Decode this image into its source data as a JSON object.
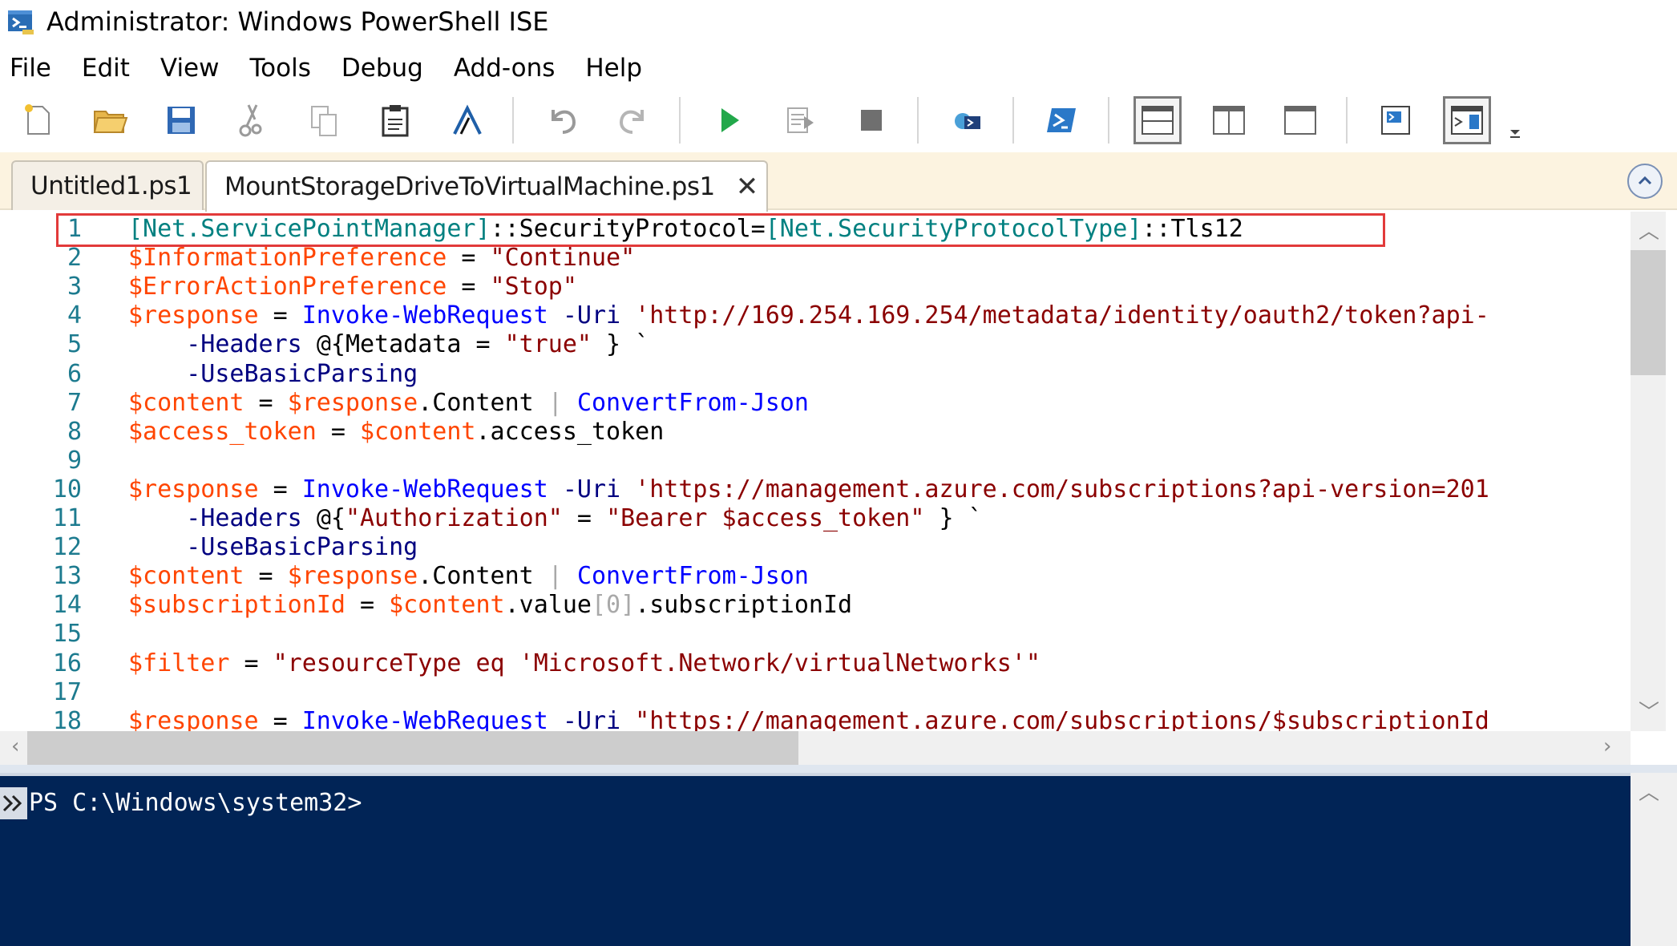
{
  "window": {
    "title": "Administrator: Windows PowerShell ISE",
    "icon": "powershell-ise-icon"
  },
  "menu": [
    "File",
    "Edit",
    "View",
    "Tools",
    "Debug",
    "Add-ons",
    "Help"
  ],
  "toolbar": {
    "icons": [
      "new-script-icon",
      "open-icon",
      "save-icon",
      "cut-icon",
      "copy-icon",
      "paste-icon",
      "clear-console-icon",
      "undo-icon",
      "redo-icon",
      "run-icon",
      "run-selection-icon",
      "stop-icon",
      "remote-powershell-icon",
      "powershell-icon",
      "layout-top-icon",
      "layout-right-icon",
      "layout-maximized-icon",
      "show-script-pane-icon",
      "show-command-addon-icon"
    ]
  },
  "tabs": [
    {
      "label": "Untitled1.ps1",
      "active": false
    },
    {
      "label": "MountStorageDriveToVirtualMachine.ps1",
      "active": true,
      "close": "✕"
    }
  ],
  "editor": {
    "lines": [
      {
        "n": "1",
        "tokens": [
          [
            "[Net.ServicePointManager]",
            "type"
          ],
          [
            "::SecurityProtocol=",
            "plain"
          ],
          [
            "[Net.SecurityProtocolType]",
            "type"
          ],
          [
            "::Tls12",
            "plain"
          ]
        ]
      },
      {
        "n": "2",
        "tokens": [
          [
            "$InformationPreference",
            "var"
          ],
          [
            " = ",
            "plain"
          ],
          [
            "\"Continue\"",
            "str"
          ]
        ]
      },
      {
        "n": "3",
        "tokens": [
          [
            "$ErrorActionPreference",
            "var"
          ],
          [
            " = ",
            "plain"
          ],
          [
            "\"Stop\"",
            "str"
          ]
        ]
      },
      {
        "n": "4",
        "tokens": [
          [
            "$response",
            "var"
          ],
          [
            " = ",
            "plain"
          ],
          [
            "Invoke-WebRequest",
            "cmd"
          ],
          [
            " -Uri ",
            "param"
          ],
          [
            "'http://169.254.169.254/metadata/identity/oauth2/token?api-",
            "str"
          ]
        ]
      },
      {
        "n": "5",
        "tokens": [
          [
            "    -Headers ",
            "param"
          ],
          [
            "@{",
            "plain"
          ],
          [
            "Metadata",
            "plain"
          ],
          [
            " = ",
            "plain"
          ],
          [
            "\"true\"",
            "str"
          ],
          [
            " } `",
            "plain"
          ]
        ]
      },
      {
        "n": "6",
        "tokens": [
          [
            "    -UseBasicParsing",
            "param"
          ]
        ]
      },
      {
        "n": "7",
        "tokens": [
          [
            "$content",
            "var"
          ],
          [
            " = ",
            "plain"
          ],
          [
            "$response",
            "var"
          ],
          [
            ".Content",
            "plain"
          ],
          [
            " | ",
            "op"
          ],
          [
            "ConvertFrom-Json",
            "cmd"
          ]
        ]
      },
      {
        "n": "8",
        "tokens": [
          [
            "$access_token",
            "var"
          ],
          [
            " = ",
            "plain"
          ],
          [
            "$content",
            "var"
          ],
          [
            ".access_token",
            "plain"
          ]
        ]
      },
      {
        "n": "9",
        "tokens": []
      },
      {
        "n": "10",
        "tokens": [
          [
            "$response",
            "var"
          ],
          [
            " = ",
            "plain"
          ],
          [
            "Invoke-WebRequest",
            "cmd"
          ],
          [
            " -Uri ",
            "param"
          ],
          [
            "'https://management.azure.com/subscriptions?api-version=201",
            "str"
          ]
        ]
      },
      {
        "n": "11",
        "tokens": [
          [
            "    -Headers ",
            "param"
          ],
          [
            "@{",
            "plain"
          ],
          [
            "\"Authorization\"",
            "str"
          ],
          [
            " = ",
            "plain"
          ],
          [
            "\"Bearer $access_token\"",
            "str"
          ],
          [
            " } `",
            "plain"
          ]
        ]
      },
      {
        "n": "12",
        "tokens": [
          [
            "    -UseBasicParsing",
            "param"
          ]
        ]
      },
      {
        "n": "13",
        "tokens": [
          [
            "$content",
            "var"
          ],
          [
            " = ",
            "plain"
          ],
          [
            "$response",
            "var"
          ],
          [
            ".Content",
            "plain"
          ],
          [
            " | ",
            "op"
          ],
          [
            "ConvertFrom-Json",
            "cmd"
          ]
        ]
      },
      {
        "n": "14",
        "tokens": [
          [
            "$subscriptionId",
            "var"
          ],
          [
            " = ",
            "plain"
          ],
          [
            "$content",
            "var"
          ],
          [
            ".value",
            "plain"
          ],
          [
            "[0]",
            "op"
          ],
          [
            ".subscriptionId",
            "plain"
          ]
        ]
      },
      {
        "n": "15",
        "tokens": []
      },
      {
        "n": "16",
        "tokens": [
          [
            "$filter",
            "var"
          ],
          [
            " = ",
            "plain"
          ],
          [
            "\"resourceType eq 'Microsoft.Network/virtualNetworks'\"",
            "str"
          ]
        ]
      },
      {
        "n": "17",
        "tokens": []
      },
      {
        "n": "18",
        "tokens": [
          [
            "$response",
            "var"
          ],
          [
            " = ",
            "plain"
          ],
          [
            "Invoke-WebRequest",
            "cmd"
          ],
          [
            " -Uri ",
            "param"
          ],
          [
            "\"https://management.azure.com/subscriptions/$subscriptionId",
            "str"
          ]
        ]
      }
    ]
  },
  "console": {
    "prompt": "PS C:\\Windows\\system32>"
  },
  "colors": {
    "console_bg": "#012456",
    "highlight_box": "#e23a3a",
    "tabbar_bg": "#fcf3e0"
  }
}
